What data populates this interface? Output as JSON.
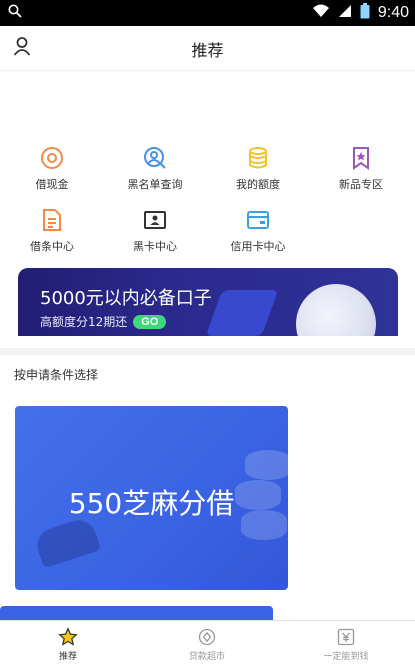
{
  "status_bar": {
    "time": "9:40"
  },
  "header": {
    "title": "推荐"
  },
  "grid": [
    {
      "label": "借现金",
      "icon": "coin-target-icon",
      "color": "#f08a4b"
    },
    {
      "label": "黑名单查询",
      "icon": "search-user-icon",
      "color": "#4a90e2"
    },
    {
      "label": "我的额度",
      "icon": "coin-stack-icon",
      "color": "#f2c230"
    },
    {
      "label": "新品专区",
      "icon": "bookmark-icon",
      "color": "#9b59b6"
    },
    {
      "label": "借条中心",
      "icon": "document-icon",
      "color": "#f08a4b"
    },
    {
      "label": "黑卡中心",
      "icon": "id-card-icon",
      "color": "#333333"
    },
    {
      "label": "信用卡中心",
      "icon": "credit-card-icon",
      "color": "#3aa0e0"
    }
  ],
  "banner": {
    "title": "5000元以内必备口子",
    "subtitle": "高额度分12期还",
    "button": "GO"
  },
  "section": {
    "title": "按申请条件选择"
  },
  "cards": [
    {
      "title": "550芝麻分借"
    }
  ],
  "tabbar": [
    {
      "label": "推荐",
      "active": true,
      "icon": "star-icon"
    },
    {
      "label": "贷款超市",
      "active": false,
      "icon": "coin-circle-icon"
    },
    {
      "label": "一定能到钱",
      "active": false,
      "icon": "yen-icon"
    }
  ]
}
